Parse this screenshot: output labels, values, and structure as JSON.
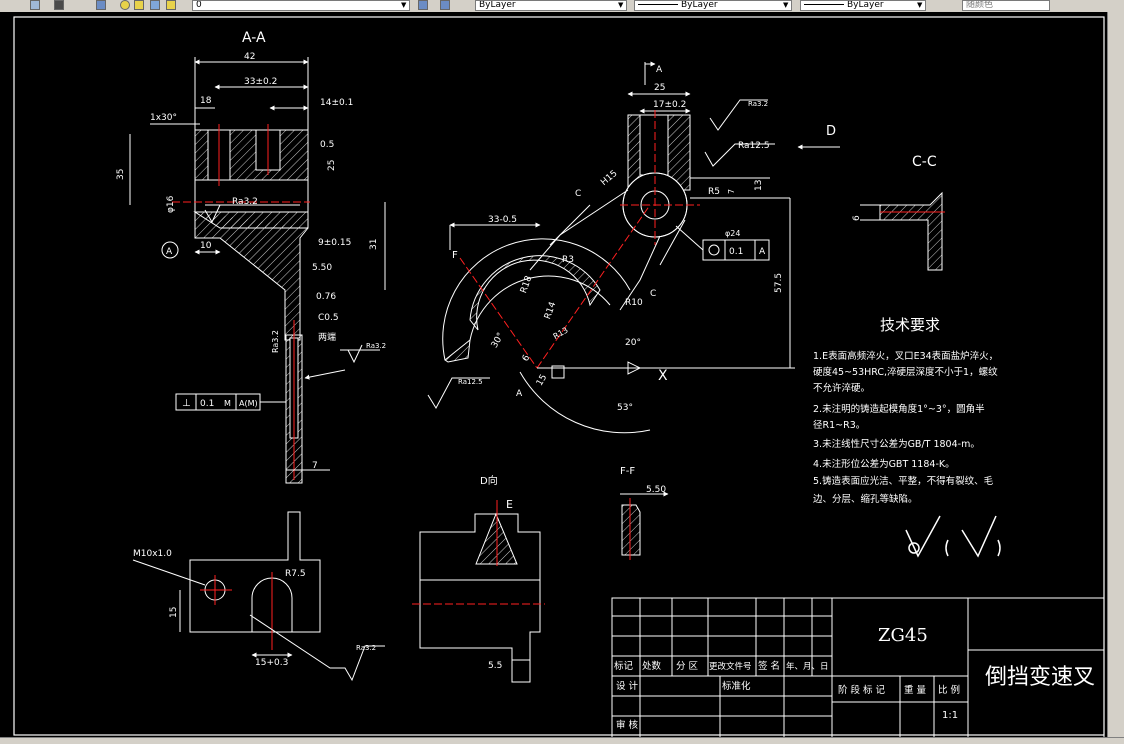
{
  "toolbar": {
    "layer_value": "0",
    "color_value": "ByLayer",
    "linetype_value": "ByLayer",
    "lineweight_value": "ByLayer",
    "plotstyle_value": "随颜色"
  },
  "drawing": {
    "section_aa": {
      "title": "A-A",
      "dim_42": "42",
      "dim_33": "33±0.2",
      "dim_18": "18",
      "dim_14": "14±0.1",
      "chamfer": "1x30°",
      "dim_35": "35",
      "dim_05": "0.5",
      "dim_25": "25",
      "dim_phi16": "φ16",
      "rough_32": "Ra3.2",
      "dim_10": "10",
      "dim_9": "9±0.15",
      "dim_31": "31",
      "dim_550": "5.50",
      "dim_076": "0.76",
      "dim_c05": "C0.5",
      "both_ends": "两端",
      "rough_32b": "Ra3.2",
      "rough_32c": "Ra3.2",
      "datum_a": "A",
      "tol_01": "0.1",
      "tol_m": "M",
      "tol_am": "A(M)",
      "dim_7": "7"
    },
    "main_view": {
      "label_a_top": "A",
      "dim_25": "25",
      "dim_17": "17±0.2",
      "rough_top": "Ra3.2",
      "rough_125": "Ra12.5",
      "label_d": "D",
      "dim_h15": "H15",
      "dim_r5": "R5",
      "dim_13": "13",
      "dim_7": "7",
      "label_c1": "C",
      "label_c2": "C",
      "dim_phi24": "φ24",
      "pos_01": "0.1",
      "pos_a": "A",
      "dim_33": "33-0.5",
      "label_f": "F",
      "dim_r18": "R18",
      "dim_r3": "R3",
      "dim_r10": "R10",
      "dim_r14": "R14",
      "dim_r13": "R13",
      "dim_30": "30°",
      "dim_20": "20°",
      "dim_6": "6",
      "dim_15": "15",
      "dim_53": "53°",
      "dim_575": "57.5",
      "rough_125b": "Ra12.5",
      "label_a_bot": "A",
      "x_mark": "X"
    },
    "section_cc": {
      "title": "C-C",
      "dim_6": "6"
    },
    "tech_req": {
      "title": "技术要求",
      "line1": "1.E表面高频淬火，叉口E34表面盐炉淬火，",
      "line2": "硬度45~53HRC,淬硬层深度不小于1，螺纹",
      "line3": "不允许淬硬。",
      "line4": "2.未注明的铸造起模角度1°~3°，圆角半",
      "line5": "径R1~R3。",
      "line6": "3.未注线性尺寸公差为GB/T 1804-m。",
      "line7": "4.未注形位公差为GBT 1184-K。",
      "line8": "5.铸造表面应光洁、平整，不得有裂纹、毛",
      "line9": "边、分层、缩孔等缺陷。"
    },
    "bottom_left": {
      "thread": "M10x1.0",
      "dim_r75": "R7.5",
      "dim_15": "15",
      "dim_15b": "15+0.3",
      "rough": "Ra3.2"
    },
    "view_d": {
      "title": "D向",
      "label_e": "E",
      "dim_55": "5.5"
    },
    "section_ff": {
      "title": "F-F",
      "dim_550": "5.50"
    },
    "title_block": {
      "material": "ZG45",
      "part_name": "倒挡变速叉",
      "h_mark": "标记",
      "h_count": "处数",
      "h_zone": "分 区",
      "h_docno": "更改文件号",
      "h_sign": "签 名",
      "h_date": "年、月、日",
      "h_design": "设 计",
      "h_std": "标准化",
      "h_stage": "阶 段 标 记",
      "h_weight": "重 量",
      "h_scale": "比 例",
      "scale_val": "1:1",
      "h_review": "审 核"
    }
  }
}
